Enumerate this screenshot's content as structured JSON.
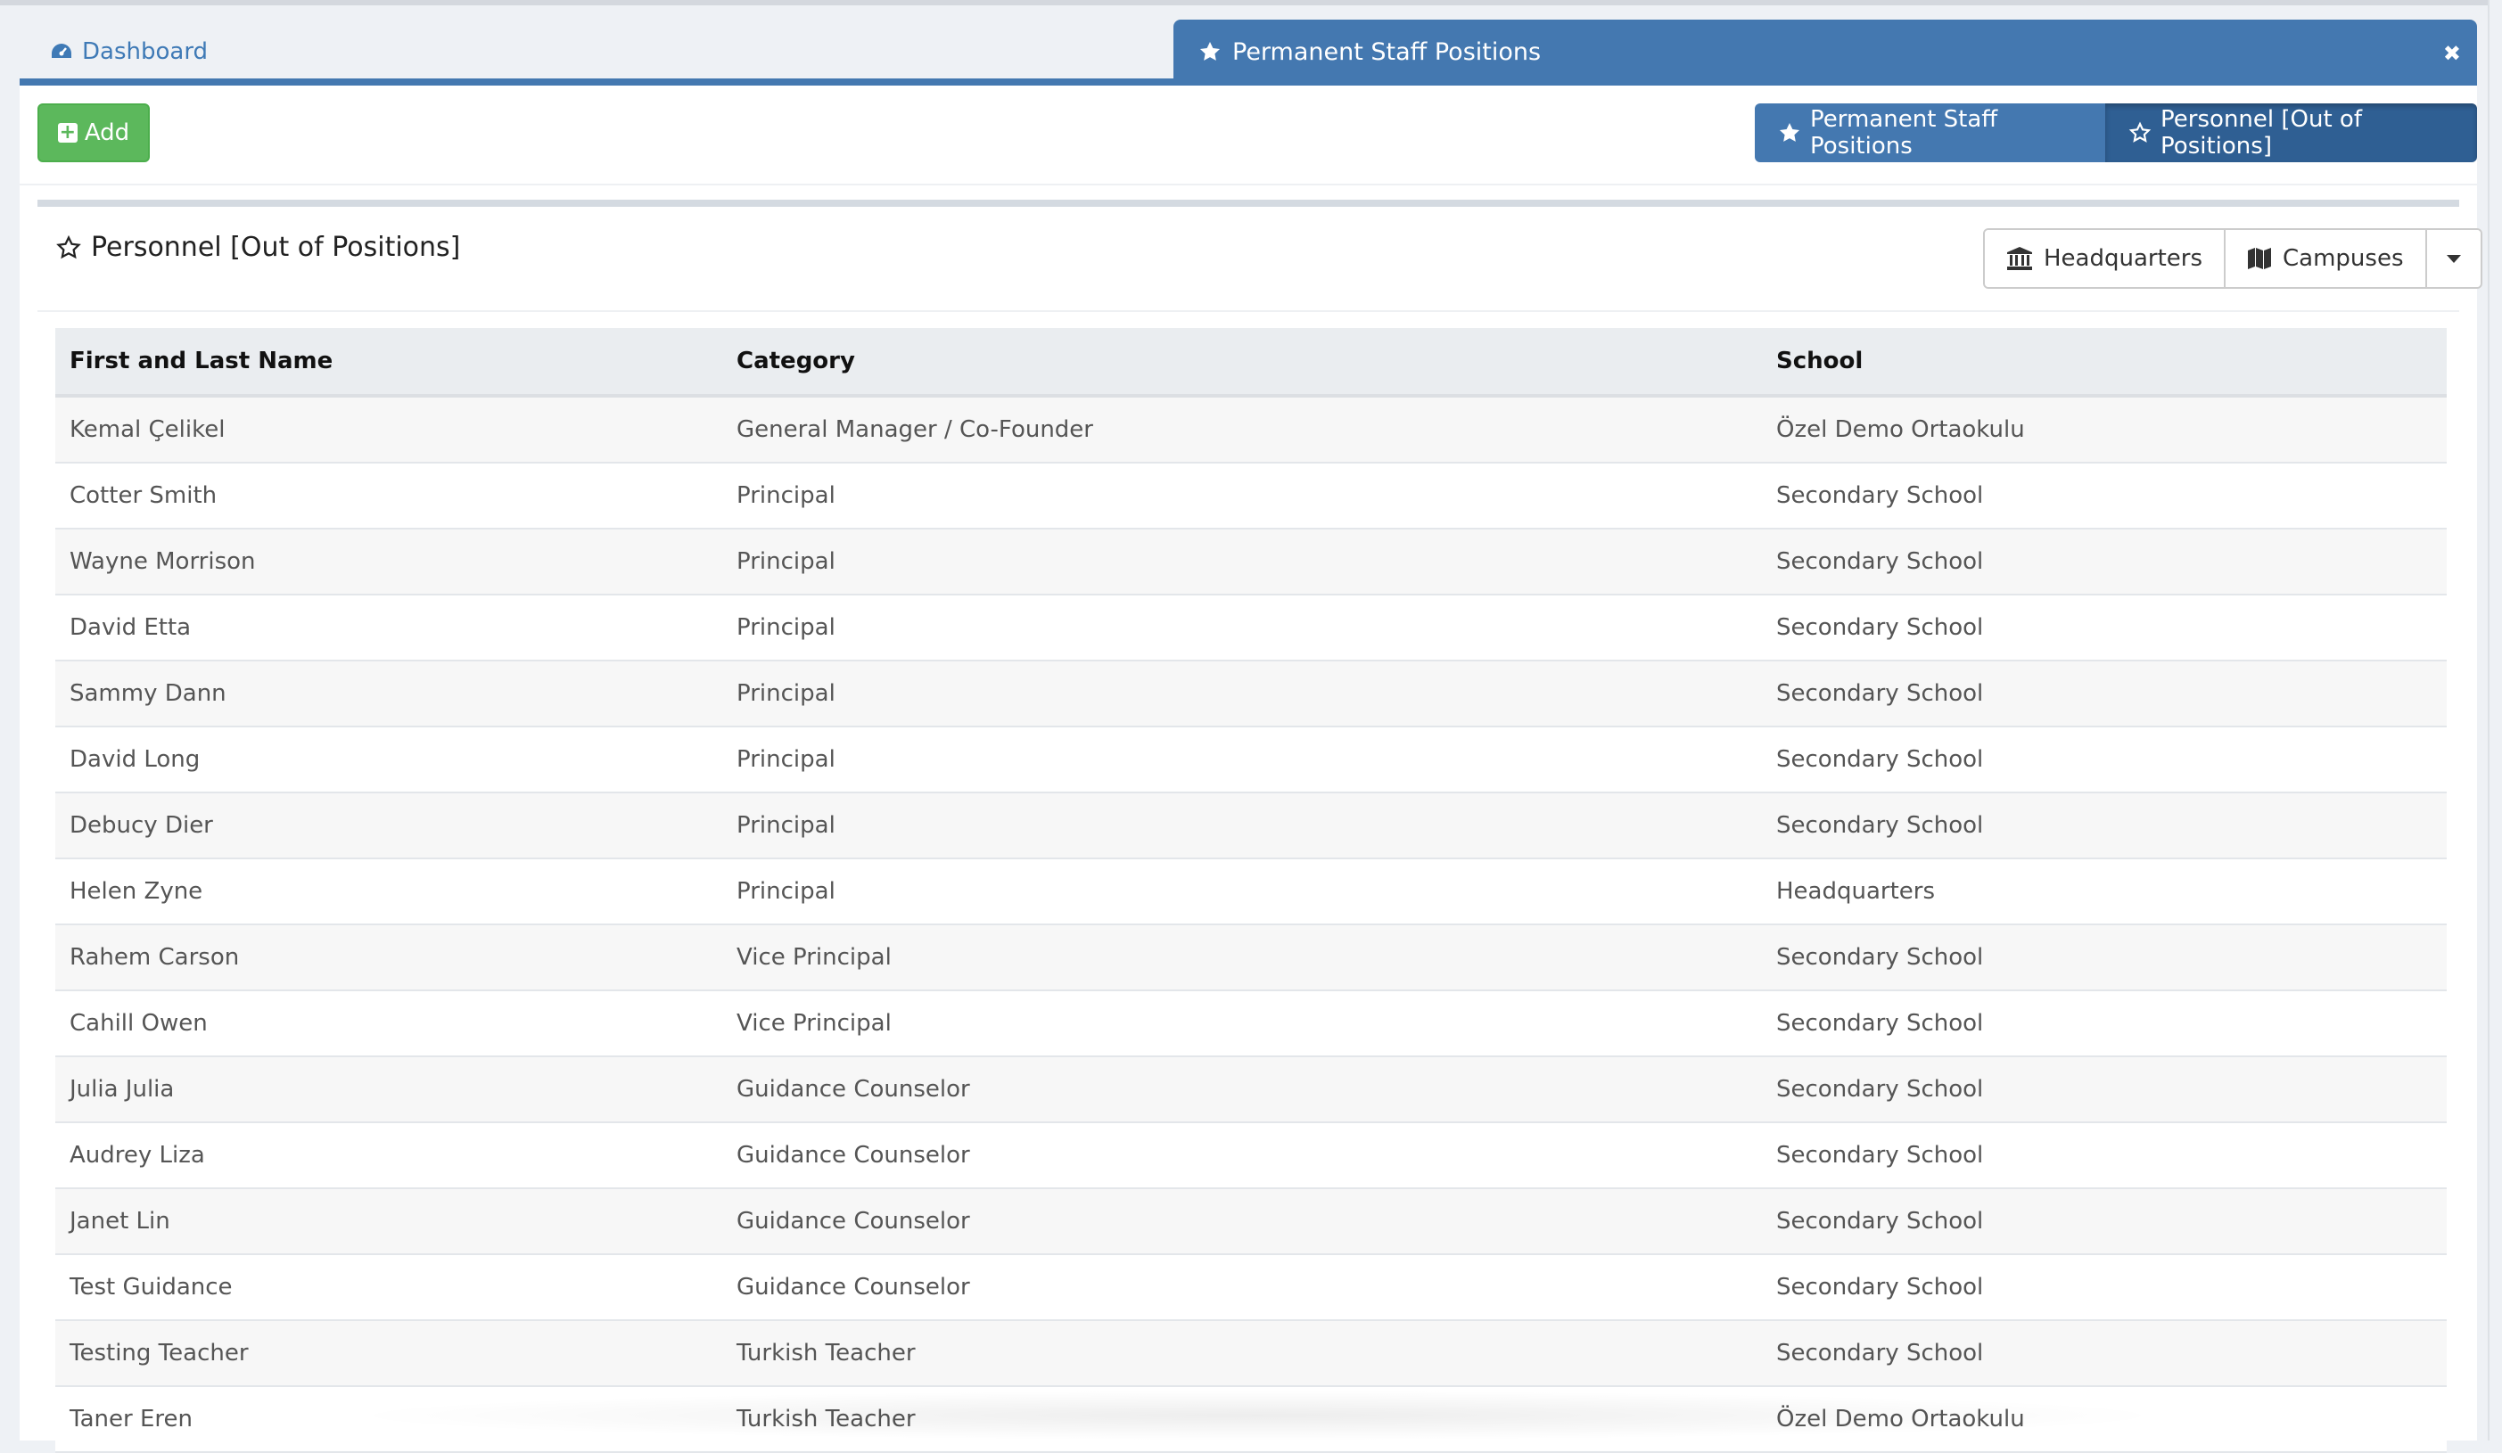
{
  "tabs": {
    "dashboard": {
      "label": "Dashboard",
      "icon": "tachometer-icon"
    },
    "active": {
      "label": "Permanent Staff Positions",
      "icon": "star-icon",
      "close": "✖"
    }
  },
  "toolbar": {
    "add_label": "Add",
    "segments": [
      {
        "label": "Permanent Staff Positions",
        "icon": "star-icon",
        "active": false
      },
      {
        "label": "Personnel [Out of Positions]",
        "icon": "star-outline-icon",
        "active": true
      }
    ]
  },
  "card": {
    "title": "Personnel [Out of Positions]",
    "filters": [
      {
        "label": "Headquarters",
        "icon": "bank-icon"
      },
      {
        "label": "Campuses",
        "icon": "map-icon"
      }
    ]
  },
  "table": {
    "columns": [
      "First and Last Name",
      "Category",
      "School"
    ],
    "rows": [
      [
        "Kemal Çelikel",
        "General Manager / Co-Founder",
        "Özel Demo Ortaokulu"
      ],
      [
        "Cotter Smith",
        "Principal",
        "Secondary School"
      ],
      [
        "Wayne Morrison",
        "Principal",
        "Secondary School"
      ],
      [
        "David Etta",
        "Principal",
        "Secondary School"
      ],
      [
        "Sammy Dann",
        "Principal",
        "Secondary School"
      ],
      [
        "David Long",
        "Principal",
        "Secondary School"
      ],
      [
        "Debucy Dier",
        "Principal",
        "Secondary School"
      ],
      [
        "Helen Zyne",
        "Principal",
        "Headquarters"
      ],
      [
        "Rahem Carson",
        "Vice Principal",
        "Secondary School"
      ],
      [
        "Cahill Owen",
        "Vice Principal",
        "Secondary School"
      ],
      [
        "Julia Julia",
        "Guidance Counselor",
        "Secondary School"
      ],
      [
        "Audrey Liza",
        "Guidance Counselor",
        "Secondary School"
      ],
      [
        "Janet Lin",
        "Guidance Counselor",
        "Secondary School"
      ],
      [
        "Test Guidance",
        "Guidance Counselor",
        "Secondary School"
      ],
      [
        "Testing Teacher",
        "Turkish Teacher",
        "Secondary School"
      ],
      [
        "Taner Eren",
        "Turkish Teacher",
        "Özel Demo Ortaokulu"
      ]
    ]
  },
  "colors": {
    "primary": "#4478b0",
    "primary_active": "#2f5f93",
    "success": "#5cb85c"
  }
}
